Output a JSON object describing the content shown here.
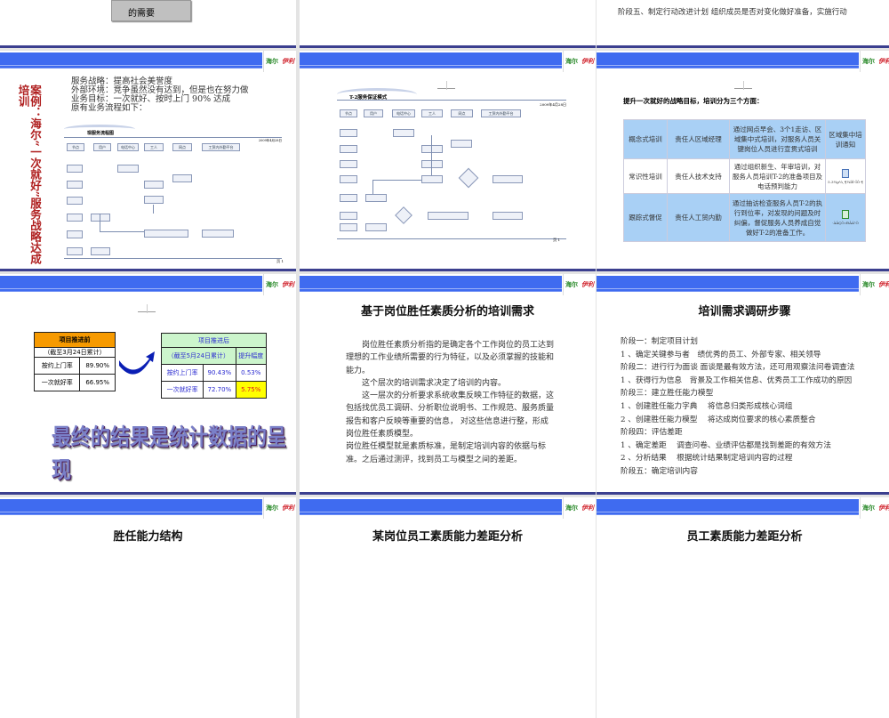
{
  "row0": {
    "left_button": "的需要",
    "right_text": "阶段五、制定行动改进计划 组织成员是否对变化做好准备，实施行动"
  },
  "logo": {
    "brand1": "海尔",
    "brand2": "伊利"
  },
  "slide_case": {
    "vertical_title": "案例：海尔“一次就好”服务战略达成培训",
    "lines": [
      "服务战略：提高社会美誉度",
      "外部环境：竞争虽然没有达到，但是也在努力做",
      "业务目标：一次就好、按时上门  90% 达成",
      "原有业务流程如下："
    ],
    "chart_title": "现服务流程图",
    "date": "2009年4月28日",
    "headers": [
      "节点",
      "用户",
      "电话中心",
      "工人",
      "网点",
      "工贸内外勤平台"
    ],
    "page": "页 1"
  },
  "slide_t2": {
    "chart_title": "T-2服务保证模式",
    "date": "2009年4月28日",
    "headers": [
      "节点",
      "用户",
      "电话中心",
      "工人",
      "网点",
      "工贸内外勤平台"
    ],
    "page": "页 1"
  },
  "slide_training": {
    "heading": "提升一次就好的战略目标，培训分为三个方面：",
    "rows": [
      {
        "type": "概念式培训",
        "owner": "责任人区域经理",
        "desc": "通过网点早会、3个1走访、区域集中式培训，对服务人员关键岗位人员进行宣贯式培训",
        "attach": "区域集中培训通知"
      },
      {
        "type": "常识性培训",
        "owner": "责任人技术支持",
        "desc": "通过组织新生、年审培训，对服务人员培训T-2的准备项目及电话预判能力",
        "attach": "5.3¼µ¼¸¶¼ÍÈ-ÎÕ·¶"
      },
      {
        "type": "跟踪式督促",
        "owner": "责任人工贸内勤",
        "desc": "通过抽访检查服务人员T-2的执行到位率，对发现的问题及时纠偏，督促服务人员养成自觉做好T-2的准备工作。",
        "attach": "·ÀÃÇÒ»ÐÂÁ¹Ò"
      }
    ]
  },
  "slide_results": {
    "before": {
      "title": "项目推进前",
      "period": "（截至3月24日累计）",
      "rows": [
        [
          "按约上门率",
          "89.90%"
        ],
        [
          "一次就好率",
          "66.95%"
        ]
      ]
    },
    "after": {
      "title": "项目推进后",
      "period": "（截至5月24日累计）",
      "lift_header": "提升幅度",
      "rows": [
        [
          "按约上门率",
          "90.43%",
          "0.53%"
        ],
        [
          "一次就好率",
          "72.70%",
          "5.75%"
        ]
      ]
    },
    "banner": "最终的结果是统计数据的呈现"
  },
  "slide_competency": {
    "title": "基于岗位胜任素质分析的培训需求",
    "paragraphs": [
      "岗位胜任素质分析指的是确定各个工作岗位的员工达到理想的工作业绩所需要的行为特征，以及必须掌握的技能和能力。",
      "这个层次的培训需求决定了培训的内容。",
      "这一层次的分析要求系统收集反映工作特征的数据，这包括找优员工调研、分析职位说明书、工作规范、服务质量报告和客户反映等重要的信息， 对这些信息进行整，形成岗位胜任素质模型。",
      "岗位胜任模型就是素质标准，是制定培训内容的依据与标准。之后通过测评，找到员工与模型之间的差距。"
    ]
  },
  "slide_steps": {
    "title": "培训需求调研步骤",
    "lines": [
      "阶段一：制定项目计划",
      "1 、确定关键参与者　绩优秀的员工、外部专家、相关领导",
      "阶段二：进行行为面谈 面谈是最有效方法，还可用观察法问卷调查法",
      "1 、获得行为信息　背景及工作相关信息、优秀员工工作成功的原因",
      "阶段三：建立胜任能力模型",
      "1 、创建胜任能力字典　 将信息归类形成核心词组",
      "2 、创建胜任能力模型　 将达成岗位要求的核心素质整合",
      "阶段四：评估差距",
      "1 、确定差距　 调查问卷、业绩评估都是找到差距的有效方法",
      "2 、分析结果　 根据统计结果制定培训内容的过程",
      "阶段五：确定培训内容"
    ]
  },
  "row3_titles": [
    "胜任能力结构",
    "某岗位员工素质能力差距分析",
    "员工素质能力差距分析"
  ],
  "colors": {
    "header_blue": "#3f6bf0",
    "bottom_line": "#3b3f8f",
    "orange": "#f79a00",
    "light_green": "#ccf5cc",
    "yellow": "#ffff00",
    "table_blue": "#a9d0f5"
  }
}
